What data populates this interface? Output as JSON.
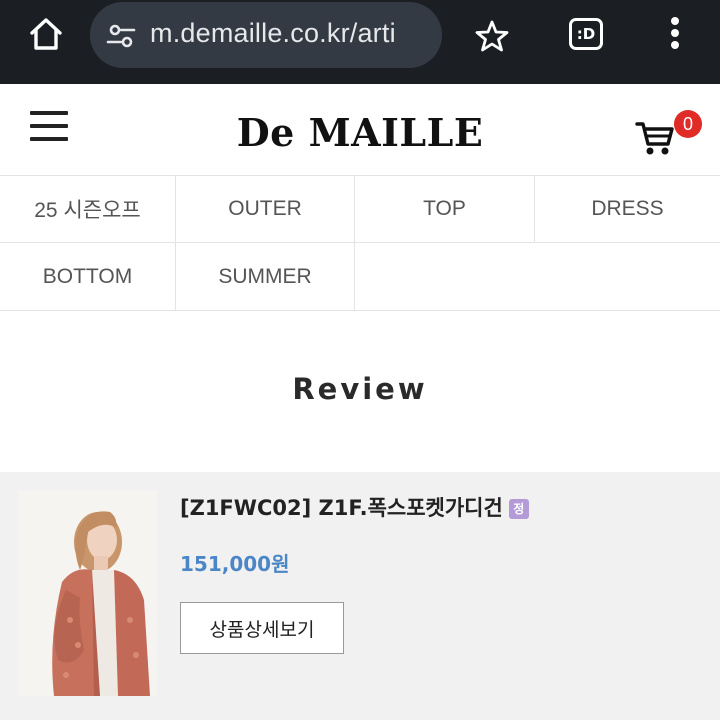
{
  "browser": {
    "url": "m.demaille.co.kr/arti",
    "tab_label": ":D"
  },
  "header": {
    "logo": "De MAILLE",
    "cart_count": "0"
  },
  "categories": [
    {
      "label": "25 시즌오프"
    },
    {
      "label": "OUTER"
    },
    {
      "label": "TOP"
    },
    {
      "label": "DRESS"
    },
    {
      "label": "BOTTOM"
    },
    {
      "label": "SUMMER"
    }
  ],
  "page": {
    "title": "Review"
  },
  "product": {
    "name": "[Z1FWC02] Z1F.폭스포켓가디건",
    "badge": "정",
    "price": "151,000원",
    "detail_button": "상품상세보기"
  },
  "colors": {
    "browser_bg": "#1b1f24",
    "url_pill": "#333a43",
    "badge_red": "#e02b27",
    "price_blue": "#4b86c7",
    "badge_purple": "#b49ad6"
  },
  "icons": [
    "home-icon",
    "tune-icon",
    "star-icon",
    "tabs-icon",
    "more-vert-icon",
    "hamburger-icon",
    "cart-icon"
  ]
}
